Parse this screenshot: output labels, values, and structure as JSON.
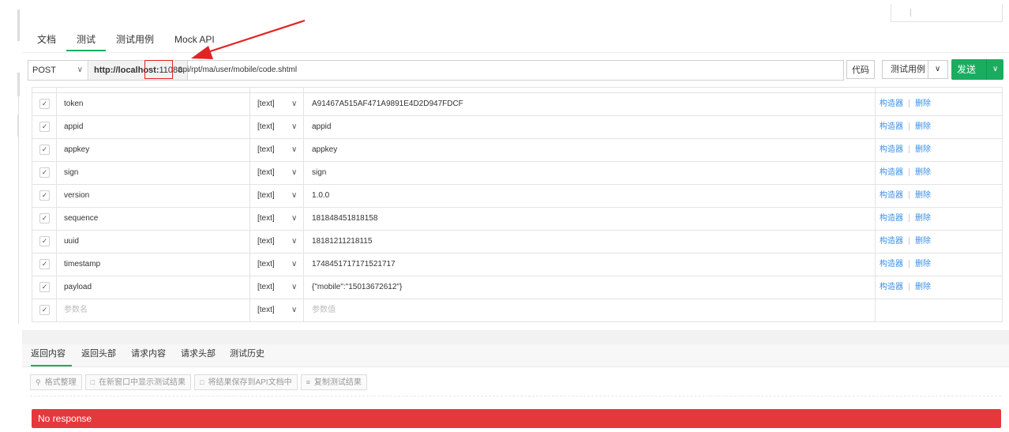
{
  "tabs": [
    "文档",
    "测试",
    "测试用例",
    "Mock API"
  ],
  "request": {
    "method": "POST",
    "host": "http://localhost:",
    "port": "11080",
    "path": "api/rpt/ma/user/mobile/code.shtml",
    "code_button": "代码",
    "cases_button": "测试用例",
    "send_button": "发送"
  },
  "params": {
    "rows": [
      {
        "name": "token",
        "type": "[text]",
        "value": "A91467A515AF471A9891E4D2D947FDCF"
      },
      {
        "name": "appid",
        "type": "[text]",
        "value": "appid"
      },
      {
        "name": "appkey",
        "type": "[text]",
        "value": "appkey"
      },
      {
        "name": "sign",
        "type": "[text]",
        "value": "sign"
      },
      {
        "name": "version",
        "type": "[text]",
        "value": "1.0.0"
      },
      {
        "name": "sequence",
        "type": "[text]",
        "value": "181848451818158"
      },
      {
        "name": "uuid",
        "type": "[text]",
        "value": "18181211218115"
      },
      {
        "name": "timestamp",
        "type": "[text]",
        "value": "1748451717171521717"
      },
      {
        "name": "payload",
        "type": "[text]",
        "value": "{\"mobile\":\"15013672612\"}"
      }
    ],
    "placeholder_row": {
      "name": "参数名",
      "type": "[text]",
      "value": "参数值"
    },
    "action_builder": "构造器",
    "action_delete": "删除"
  },
  "response": {
    "tabs": [
      "返回内容",
      "返回头部",
      "请求内容",
      "请求头部",
      "测试历史"
    ],
    "toolbar": [
      "格式整理",
      "在新窗口中显示测试结果",
      "将结果保存到API文档中",
      "复制测试结果"
    ],
    "no_response": "No response"
  },
  "colors": {
    "accent": "#1aad60",
    "error": "#e5383b",
    "link": "#3a8ee6",
    "annotation": "#e02424"
  }
}
